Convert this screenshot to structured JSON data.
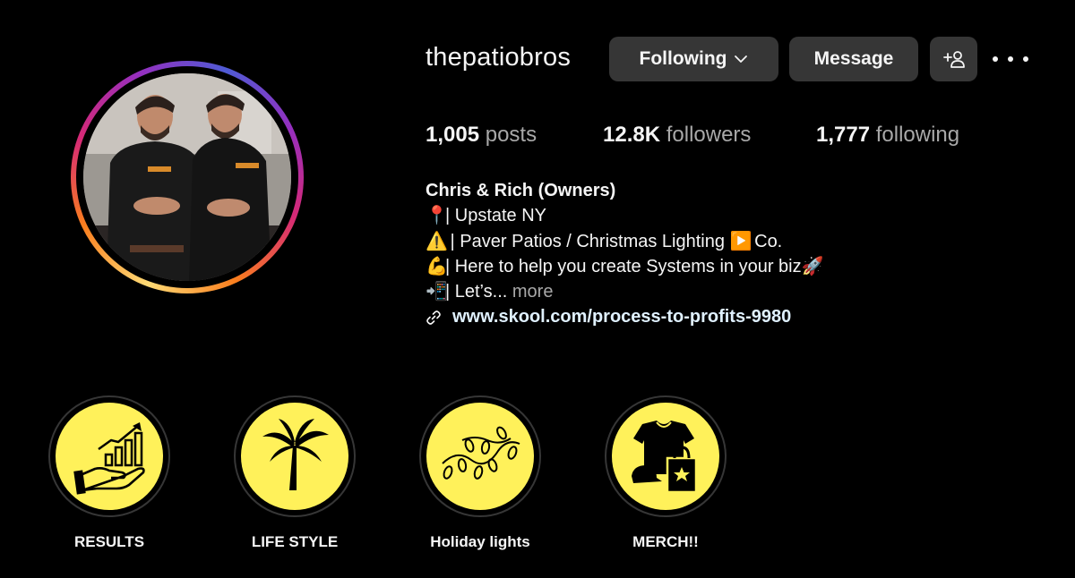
{
  "profile": {
    "username": "thepatiobros",
    "buttons": {
      "following": "Following",
      "message": "Message"
    },
    "stats": {
      "posts_count": "1,005",
      "posts_label": "posts",
      "followers_count": "12.8K",
      "followers_label": "followers",
      "following_count": "1,777",
      "following_label": "following"
    },
    "bio": {
      "name": "Chris & Rich (Owners)",
      "line1_emoji": "📍",
      "line1": "| Upstate NY",
      "line2_emoji": "⚠️",
      "line2a": " | Paver Patios / Christmas Lighting ",
      "line2_emoji2": "▶️",
      "line2b": " Co.",
      "line3_emoji": "💪",
      "line3": "| Here to help you create Systems in your biz",
      "line3_emoji2": "🚀",
      "line4_emoji": "📲",
      "line4": "| Let’s... ",
      "more": "more",
      "link": "www.skool.com/process-to-profits-9980"
    }
  },
  "highlights": [
    {
      "label": "RESULTS",
      "icon": "growth-chart-hand-icon"
    },
    {
      "label": "LIFE STYLE",
      "icon": "palm-tree-icon"
    },
    {
      "label": "Holiday lights",
      "icon": "string-lights-icon"
    },
    {
      "label": "MERCH!!",
      "icon": "merch-shirt-bag-icon"
    }
  ],
  "colors": {
    "background": "#000000",
    "button": "#363636",
    "secondary_text": "#a8a8a8",
    "link": "#e0f1ff",
    "highlight_fill": "#fff15a"
  }
}
